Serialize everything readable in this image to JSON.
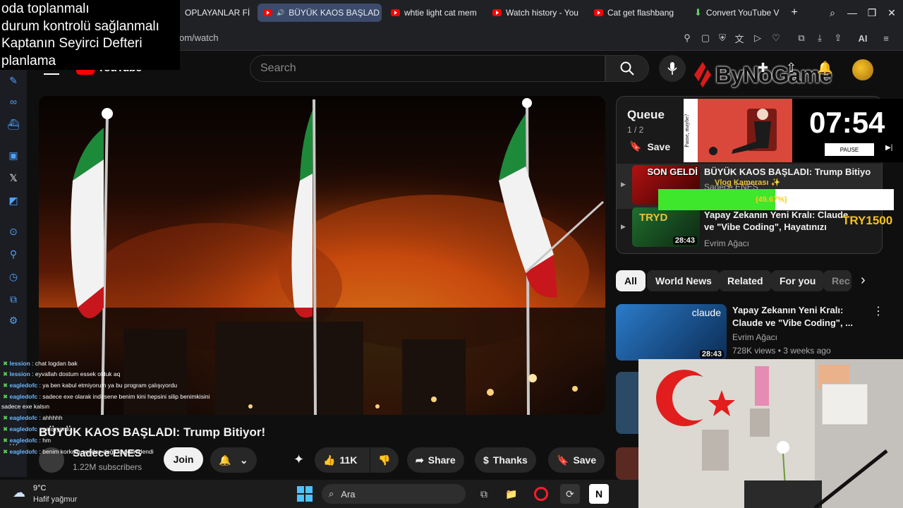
{
  "notes_overlay": {
    "lines": [
      "oda toplanmalı",
      "durum kontrolü sağlanmalı",
      "Kaptanın Seyirci Defteri",
      "planlama"
    ]
  },
  "browser": {
    "tabs": [
      {
        "label": "OPLAYANLAR FİL",
        "active": false
      },
      {
        "label": "BÜYÜK KAOS BAŞLAD",
        "active": true
      },
      {
        "label": "whtie light cat mem",
        "active": false
      },
      {
        "label": "Watch history - You",
        "active": false
      },
      {
        "label": "Cat get flashbang",
        "active": false
      },
      {
        "label": "Convert YouTube V",
        "active": false
      }
    ],
    "new_tab": "+",
    "url_tail": "om/watch",
    "ai_label": "AI"
  },
  "youtube": {
    "logo": "YouTube",
    "search_placeholder": "Search",
    "video_title": "BÜYÜK KAOS BAŞLADI: Trump Bitiyor!",
    "channel_name": "Sadece ENES",
    "subscribers": "1.22M subscribers",
    "join": "Join",
    "likes": "11K",
    "share": "Share",
    "thanks": "Thanks",
    "save": "Save"
  },
  "queue": {
    "title": "Queue",
    "position": "1 / 2",
    "save": "Save",
    "items": [
      {
        "title": "BÜYÜK KAOS BAŞLADI: Trump Bitiyor!",
        "channel": "Sadece ENES",
        "thumb_text": "SON GELDİ"
      },
      {
        "title": "Yapay Zekanın Yeni Kralı: Claude ve \"Vibe Coding\", Hayatınızı Nas...",
        "channel": "Evrim Ağacı",
        "duration": "28:43",
        "thumb_text": "TRYD"
      }
    ]
  },
  "chips": [
    "All",
    "World News",
    "Related",
    "For you",
    "Rec"
  ],
  "recommendations": [
    {
      "title": "Yapay Zekanın Yeni Kralı: Claude ve \"Vibe Coding\", ...",
      "channel": "Evrim Ağacı",
      "meta": "728K views • 3 weeks ago",
      "duration": "28:43",
      "thumb_text": "claude"
    }
  ],
  "stream_overlay": {
    "timer": "07:54",
    "pause_button": "PAUSE",
    "side_caption": "Pause, maybe?",
    "brand": "ByNoGame",
    "vlog_label": "Vlog Kamerası ✨",
    "progress_text": "(49.67%)",
    "progress_fraction": 0.4967,
    "try_amount": "TRY1500"
  },
  "chat": [
    {
      "user": "lession",
      "msg": "chat logdan bak"
    },
    {
      "user": "lession",
      "msg": "eyvallah dostum essek olduk aq"
    },
    {
      "user": "eagledofc",
      "msg": "ya ben kabul etmiyorum ya bu program çalışıyordu"
    },
    {
      "user": "eagledofc",
      "msg": "sadece exe olarak indirsene benim kini hepsini silip benimkisini"
    },
    {
      "user": "",
      "msg": "sadece exe kalsın"
    },
    {
      "user": "eagledofc",
      "msg": "ahhhhh"
    },
    {
      "user": "eagledofc",
      "msg": "çalışıyordu"
    },
    {
      "user": "eagledofc",
      "msg": "hm"
    },
    {
      "user": "eagledofc",
      "msg": "benim korkum senden değil kaderimdendi"
    }
  ],
  "taskbar": {
    "temperature": "9°C",
    "weather": "Hafif yağmur",
    "search_label": "Ara"
  },
  "colors": {
    "bg": "#0f0f0f",
    "accent_red": "#ff0000",
    "progress_green": "#3ee62c",
    "link_blue": "#4ea1ff"
  }
}
